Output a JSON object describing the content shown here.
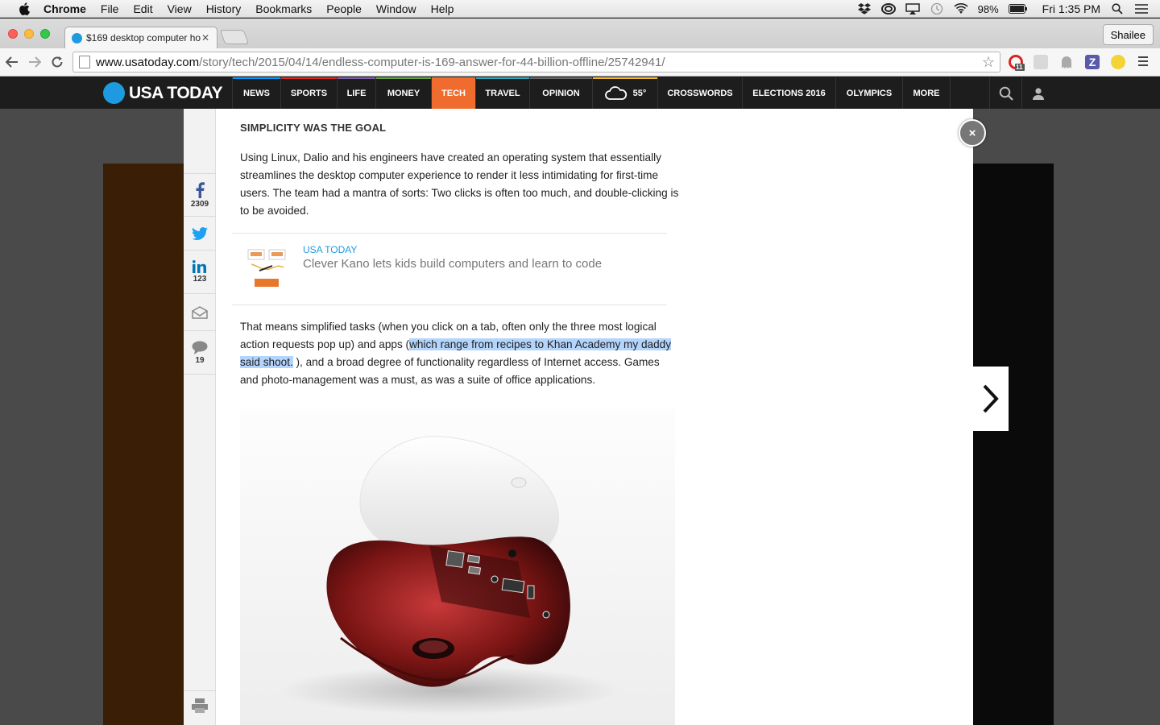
{
  "menubar": {
    "app": "Chrome",
    "items": [
      "File",
      "Edit",
      "View",
      "History",
      "Bookmarks",
      "People",
      "Window",
      "Help"
    ],
    "battery": "98%",
    "clock": "Fri 1:35 PM"
  },
  "browser": {
    "tab_title": "$169 desktop computer ho",
    "profile": "Shailee",
    "url_host": "www.usatoday.com",
    "url_path": "/story/tech/2015/04/14/endless-computer-is-169-answer-for-44-billion-offline/25742941/",
    "ext_badge": "11"
  },
  "site": {
    "logo": "USA TODAY",
    "nav": [
      {
        "label": "NEWS",
        "color": "#009bff"
      },
      {
        "label": "SPORTS",
        "color": "#da291c"
      },
      {
        "label": "LIFE",
        "color": "#7b5ea7"
      },
      {
        "label": "MONEY",
        "color": "#66a342"
      },
      {
        "label": "TECH",
        "color": "#ef6c2e"
      },
      {
        "label": "TRAVEL",
        "color": "#2fa7bd"
      },
      {
        "label": "OPINION",
        "color": "#666666"
      },
      {
        "label": "CROSSWORDS",
        "color": "#666666"
      },
      {
        "label": "ELECTIONS 2016",
        "color": "#666666"
      },
      {
        "label": "OLYMPICS",
        "color": "#666666"
      },
      {
        "label": "MORE",
        "color": "#666666"
      }
    ],
    "weather_temp": "55°"
  },
  "share": {
    "facebook_count": "2309",
    "linkedin_count": "123",
    "comments_count": "19"
  },
  "article": {
    "section_heading": "SIMPLICITY WAS THE GOAL",
    "para1": "Using Linux, Dalio and his engineers have created an operating system that essentially streamlines the desktop computer experience to render it less intimidating for first-time users. The team had a mantra of sorts: Two clicks is often too much, and double-clicking is to be avoided.",
    "related_source": "USA TODAY",
    "related_title": "Clever Kano lets kids build computers and learn to code",
    "para2_a": "That means simplified tasks (when you click on a tab, often only the three most logical action requests pop up) and apps (",
    "para2_hl": "which range from recipes to Khan Academy my daddy said shoot.",
    "para2_b": " ), and a broad degree of functionality regardless of Internet access. Games and photo-management was a must, as was a suite of office applications."
  },
  "close_label": "×"
}
